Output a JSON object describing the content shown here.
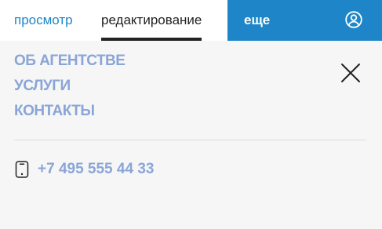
{
  "tabs": {
    "view_label": "просмотр",
    "edit_label": "редактирование",
    "more_label": "еще"
  },
  "menu": {
    "items": [
      {
        "label": "ОБ АГЕНТСТВЕ"
      },
      {
        "label": "УСЛУГИ"
      },
      {
        "label": "КОНТАКТЫ"
      }
    ]
  },
  "contact": {
    "phone": "+7 495 555 44 33"
  },
  "icons": {
    "user": "user-icon",
    "close": "close-icon",
    "phone": "phone-icon"
  },
  "colors": {
    "accent": "#1e86c8",
    "link": "#8aa5d7",
    "text": "#222222",
    "background": "#f6f6f6"
  }
}
